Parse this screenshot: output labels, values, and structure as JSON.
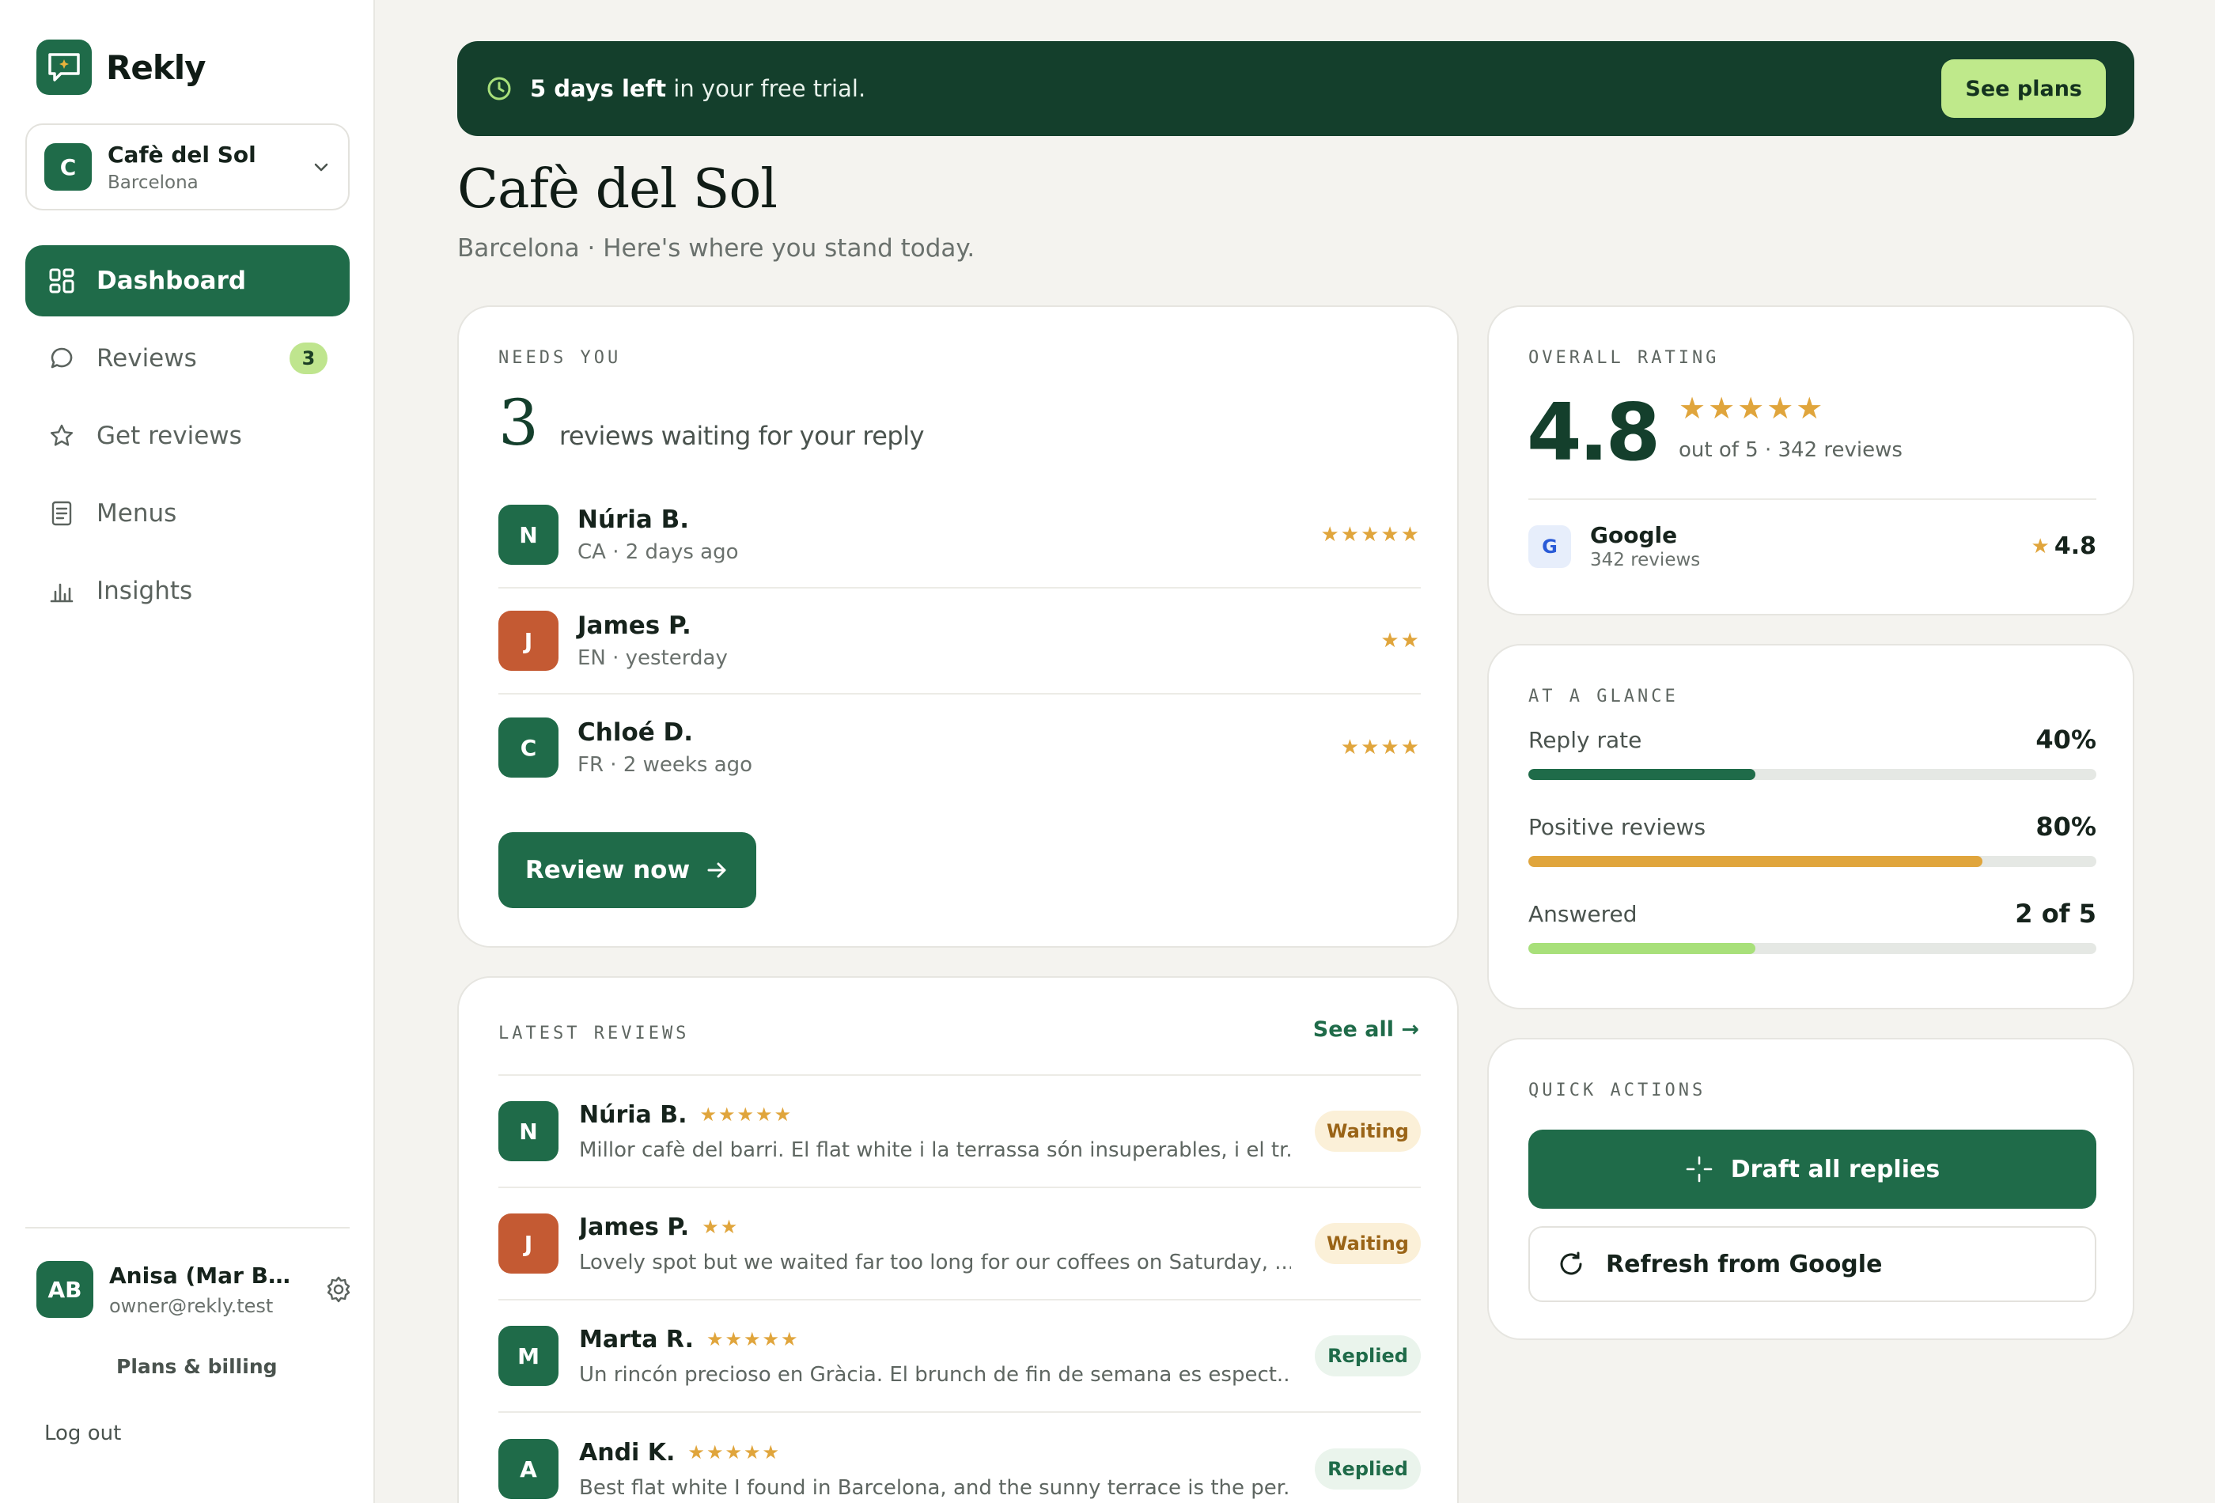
{
  "app": {
    "name": "Rekly"
  },
  "business": {
    "name": "Cafè del Sol",
    "city": "Barcelona",
    "initial": "C"
  },
  "nav": [
    {
      "label": "Dashboard",
      "icon": "grid-icon",
      "active": true
    },
    {
      "label": "Reviews",
      "icon": "chat-bubble-icon",
      "badge": "3"
    },
    {
      "label": "Get reviews",
      "icon": "star-outline-icon"
    },
    {
      "label": "Menus",
      "icon": "document-icon"
    },
    {
      "label": "Insights",
      "icon": "bar-chart-icon"
    }
  ],
  "user": {
    "initials": "AB",
    "name": "Anisa (Mar Bea...",
    "email": "owner@rekly.test"
  },
  "sidebar_footer": {
    "plans": "Plans & billing",
    "logout": "Log out"
  },
  "trial": {
    "bold": "5 days left",
    "rest": " in your free trial.",
    "button": "See plans"
  },
  "page": {
    "title": "Cafè del Sol",
    "subtitle": "Barcelona · Here's where you stand today."
  },
  "needs_you": {
    "eyebrow": "NEEDS YOU",
    "count": "3",
    "count_text": "reviews waiting for your reply",
    "items": [
      {
        "initial": "N",
        "name": "Núria B.",
        "meta": "CA · 2 days ago",
        "stars": "★★★★★",
        "color": "green"
      },
      {
        "initial": "J",
        "name": "James P.",
        "meta": "EN · yesterday",
        "stars": "★★",
        "color": "orange"
      },
      {
        "initial": "C",
        "name": "Chloé D.",
        "meta": "FR · 2 weeks ago",
        "stars": "★★★★",
        "color": "green"
      }
    ],
    "button": "Review now"
  },
  "latest": {
    "eyebrow": "LATEST REVIEWS",
    "see_all": "See all →",
    "items": [
      {
        "initial": "N",
        "name": "Núria B.",
        "stars": "★★★★★",
        "text": "Millor cafè del barri. El flat white i la terrassa són insuperables, i el tr...",
        "status": "Waiting",
        "color": "green"
      },
      {
        "initial": "J",
        "name": "James P.",
        "stars": "★★",
        "text": "Lovely spot but we waited far too long for our coffees on Saturday, ...",
        "status": "Waiting",
        "color": "orange"
      },
      {
        "initial": "M",
        "name": "Marta R.",
        "stars": "★★★★★",
        "text": "Un rincón precioso en Gràcia. El brunch de fin de semana es espect...",
        "status": "Replied",
        "color": "green"
      },
      {
        "initial": "A",
        "name": "Andi K.",
        "stars": "★★★★★",
        "text": "Best flat white I found in Barcelona, and the sunny terrace is the per...",
        "status": "Replied",
        "color": "green"
      }
    ]
  },
  "rating": {
    "eyebrow": "OVERALL RATING",
    "value": "4.8",
    "stars": "★★★★★",
    "detail": "out of 5 · 342 reviews",
    "source": {
      "letter": "G",
      "name": "Google",
      "count": "342 reviews",
      "score": "4.8"
    }
  },
  "glance": {
    "eyebrow": "AT A GLANCE",
    "metrics": [
      {
        "label": "Reply rate",
        "value": "40%",
        "fill": 0.4,
        "color": "#1f6b49"
      },
      {
        "label": "Positive reviews",
        "value": "80%",
        "fill": 0.8,
        "color": "#e0a53c"
      },
      {
        "label": "Answered",
        "value": "2 of 5",
        "fill": 0.4,
        "color": "#a8e07a"
      }
    ]
  },
  "quick": {
    "eyebrow": "QUICK ACTIONS",
    "draft": "Draft all replies",
    "refresh": "Refresh from Google"
  }
}
